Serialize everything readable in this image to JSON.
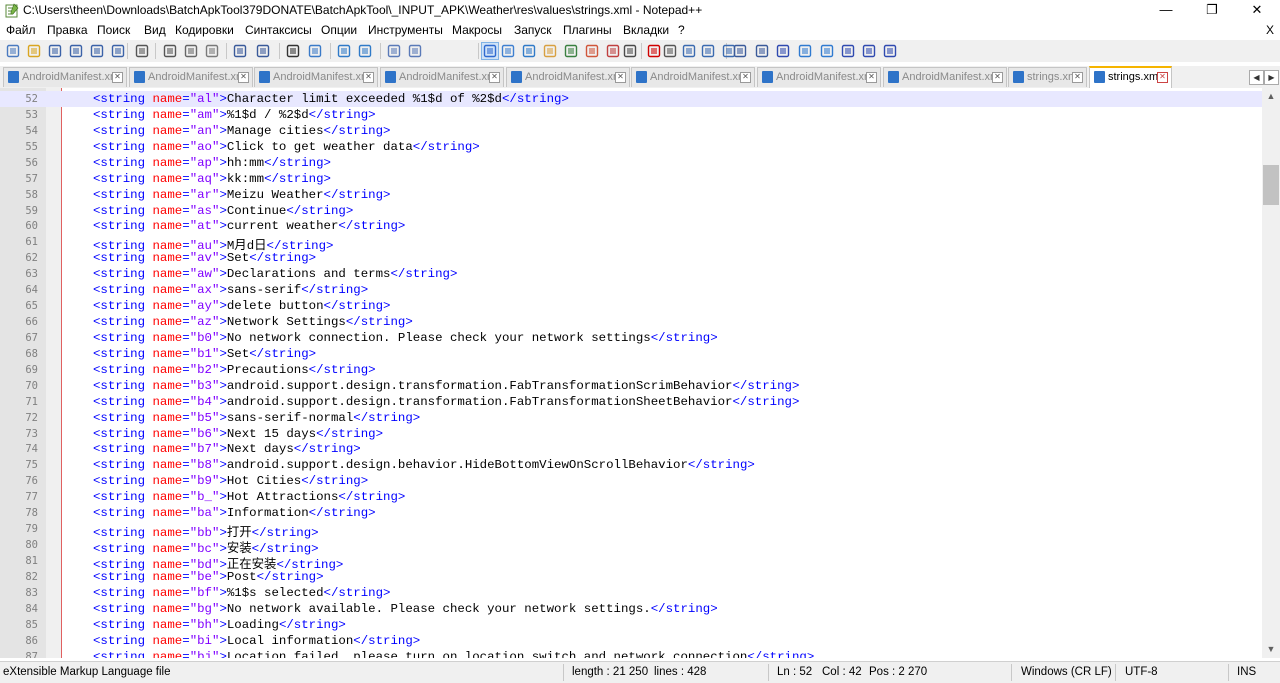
{
  "window": {
    "title": "C:\\Users\\theen\\Downloads\\BatchApkTool379DONATE\\BatchApkTool\\_INPUT_APK\\Weather\\res\\values\\strings.xml - Notepad++",
    "minimize": "—",
    "restore": "❐",
    "close": "✕"
  },
  "menu": {
    "items": [
      "Файл",
      "Правка",
      "Поиск",
      "Вид",
      "Кодировки",
      "Синтаксисы",
      "Опции",
      "Инструменты",
      "Макросы",
      "Запуск",
      "Плагины",
      "Вкладки",
      "?"
    ],
    "close_doc": "X"
  },
  "toolbar": {
    "icons": [
      "new-file-icon",
      "open-file-icon",
      "save-icon",
      "save-all-icon",
      "close-icon",
      "close-all-icon",
      "print-icon",
      "cut-icon",
      "copy-icon",
      "paste-icon",
      "undo-icon",
      "redo-icon",
      "find-icon",
      "replace-icon",
      "zoom-in-icon",
      "zoom-out-icon",
      "sync-vertical-icon",
      "sync-horizontal-icon",
      "word-wrap-icon",
      "show-all-chars-icon",
      "indent-guide-icon",
      "user-defined-lang-icon",
      "doc-map-icon",
      "function-list-icon",
      "folder-workspace-icon",
      "monitoring-icon",
      "record-macro-icon",
      "stop-record-icon",
      "play-macro-icon",
      "run-macro-multiple-icon",
      "save-macro-icon",
      "collapse-icon",
      "expand-icon",
      "compare-icon",
      "prev-icon",
      "next-icon",
      "first-icon",
      "last-icon",
      "fold-icon"
    ]
  },
  "tabs": [
    {
      "label": "AndroidManifest.xml",
      "active": false
    },
    {
      "label": "AndroidManifest.xml",
      "active": false
    },
    {
      "label": "AndroidManifest.xml",
      "active": false
    },
    {
      "label": "AndroidManifest.xml",
      "active": false
    },
    {
      "label": "AndroidManifest.xml",
      "active": false
    },
    {
      "label": "AndroidManifest.xml",
      "active": false
    },
    {
      "label": "AndroidManifest.xml",
      "active": false
    },
    {
      "label": "AndroidManifest.xml",
      "active": false
    },
    {
      "label": "strings.xml",
      "active": false
    },
    {
      "label": "strings.xml",
      "active": true
    }
  ],
  "tab_close_glyph": "✕",
  "tab_nav": {
    "prev": "◀",
    "next": "▶",
    "close": "✕"
  },
  "editor": {
    "current_line": 52,
    "lines": [
      {
        "n": "52",
        "name": "al",
        "text": "Character limit exceeded %1$d of %2$d"
      },
      {
        "n": "53",
        "name": "am",
        "text": "%1$d / %2$d"
      },
      {
        "n": "54",
        "name": "an",
        "text": "Manage cities"
      },
      {
        "n": "55",
        "name": "ao",
        "text": "Click to get weather data"
      },
      {
        "n": "56",
        "name": "ap",
        "text": "hh:mm"
      },
      {
        "n": "57",
        "name": "aq",
        "text": "kk:mm"
      },
      {
        "n": "58",
        "name": "ar",
        "text": "Meizu Weather"
      },
      {
        "n": "59",
        "name": "as",
        "text": "Continue"
      },
      {
        "n": "60",
        "name": "at",
        "text": "current weather"
      },
      {
        "n": "61",
        "name": "au",
        "text": "M月d日"
      },
      {
        "n": "62",
        "name": "av",
        "text": "Set"
      },
      {
        "n": "63",
        "name": "aw",
        "text": "Declarations and terms"
      },
      {
        "n": "64",
        "name": "ax",
        "text": "sans-serif"
      },
      {
        "n": "65",
        "name": "ay",
        "text": "delete button"
      },
      {
        "n": "66",
        "name": "az",
        "text": "Network Settings"
      },
      {
        "n": "67",
        "name": "b0",
        "text": "No network connection. Please check your network settings"
      },
      {
        "n": "68",
        "name": "b1",
        "text": "Set"
      },
      {
        "n": "69",
        "name": "b2",
        "text": "Precautions"
      },
      {
        "n": "70",
        "name": "b3",
        "text": "android.support.design.transformation.FabTransformationScrimBehavior"
      },
      {
        "n": "71",
        "name": "b4",
        "text": "android.support.design.transformation.FabTransformationSheetBehavior"
      },
      {
        "n": "72",
        "name": "b5",
        "text": "sans-serif-normal"
      },
      {
        "n": "73",
        "name": "b6",
        "text": "Next 15 days"
      },
      {
        "n": "74",
        "name": "b7",
        "text": "Next days"
      },
      {
        "n": "75",
        "name": "b8",
        "text": "android.support.design.behavior.HideBottomViewOnScrollBehavior"
      },
      {
        "n": "76",
        "name": "b9",
        "text": "Hot Cities"
      },
      {
        "n": "77",
        "name": "b_",
        "text": "Hot Attractions"
      },
      {
        "n": "78",
        "name": "ba",
        "text": "Information"
      },
      {
        "n": "79",
        "name": "bb",
        "text": "打开"
      },
      {
        "n": "80",
        "name": "bc",
        "text": "安装"
      },
      {
        "n": "81",
        "name": "bd",
        "text": "正在安装"
      },
      {
        "n": "82",
        "name": "be",
        "text": "Post"
      },
      {
        "n": "83",
        "name": "bf",
        "text": "%1$s selected"
      },
      {
        "n": "84",
        "name": "bg",
        "text": "No network available. Please check your network settings."
      },
      {
        "n": "85",
        "name": "bh",
        "text": "Loading"
      },
      {
        "n": "86",
        "name": "bi",
        "text": "Local information"
      },
      {
        "n": "87",
        "name": "bj",
        "text": "Location failed, please turn on location switch and network connection"
      }
    ]
  },
  "statusbar": {
    "filetype": "eXtensible Markup Language file",
    "length": "length : 21 250",
    "lines": "lines : 428",
    "ln": "Ln : 52",
    "col": "Col : 42",
    "pos": "Pos : 2 270",
    "eol": "Windows (CR LF)",
    "encoding": "UTF-8",
    "mode": "INS"
  },
  "colors": {
    "tag": "#0000ff",
    "attr": "#ff0000",
    "value": "#8000ff",
    "active_tab": "#f5b400"
  }
}
